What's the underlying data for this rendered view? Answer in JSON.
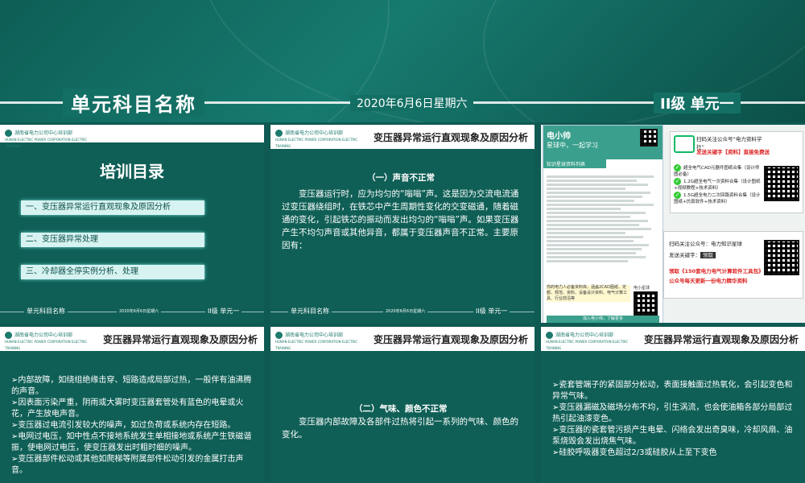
{
  "banner": {
    "title": "单元科目名称",
    "date": "2020年6月6日星期六",
    "level": "II级 单元一"
  },
  "org_name_cn": "湖南省电力公司中心培训部",
  "org_name_en": "HUNAN ELECTRIC POWER CORPORATION ELECTRIC TRAINING",
  "footer": {
    "unit": "单元科目名称",
    "date": "2020年6月6日星期六",
    "level": "II级 单元一"
  },
  "slide_title": "变压器异常运行直观现象及原因分析",
  "toc": {
    "title": "培训目录",
    "items": [
      "一、变压器异常运行直观现象及原因分析",
      "二、变压器异常处理",
      "三、冷却器全停实例分析、处理"
    ]
  },
  "slide2": {
    "heading": "（一）声音不正常",
    "para": "变压器运行时，应为均匀的“嗡嗡”声。这是因为交流电流通过变压器绕组时，在铁芯中产生周期性变化的交变磁通，随着磁通的变化，引起铁芯的振动而发出均匀的“嗡嗡”声。如果变压器产生不均匀声音或其他异音，都属于变压器声音不正常。主要原因有："
  },
  "slide4": {
    "items": [
      "➢内部故障，如绕组绝缘击穿、短路造成局部过热，一般伴有油沸腾的声音。",
      "➢因表面污染严重，阴雨或大雾时变压器套管处有蓝色的电晕或火花，产生放电声音。",
      "➢变压器过电流引发较大的噪声，如过负荷或系统内存在短路。",
      "➢电网过电压，如中性点不接地系统发生单相接地或系统产生铁磁谐振，使电网过电压，使变压器发出时粗时细的噪声。",
      "➢变压器部件松动或其他如爬梯等附属部件松动引发的金属打击声音。"
    ]
  },
  "slide5": {
    "heading": "（二）气味、颜色不正常",
    "para": "变压器内部故障及各部件过热将引起一系列的气味、颜色的变化。"
  },
  "slide6": {
    "items": [
      "➢瓷套管端子的紧固部分松动，表面接触面过热氧化，会引起变色和异常气味。",
      "➢变压器漏磁及磁场分布不均，引生涡流，也会使油箱各部分局部过热引起油漆变色。",
      "➢变压器的瓷套管污损产生电晕、闪络会发出奇臭味，冷却风扇、油泵烧毁会发出烧焦气味。",
      "➢硅胶呼吸器变色超过2/3或硅胶从上至下变色"
    ]
  },
  "ad": {
    "app_name": "电小帅",
    "app_sub": "星球中，一起学习",
    "tag": "知识星球资料列表",
    "promo": "你的电力人必备资料库，涵盖2CAD图纸、定额、规范、资料、设备设计资料、电气计算工具、行业前沿等",
    "scan_text": "加入电小帅，了解更多",
    "star_label": "电小星球",
    "wx1_title": "扫码关注公众号“电力资料学社”",
    "wx1_keyword": "发送关键字【资料】直接免费送",
    "offers": [
      "超全电气CAD元器件图纸合集（设计师图必备）",
      "1.2G超全电气一次资料合集（设计图纸+视频教程+技术资料）",
      "1.5G超全电力二次回路资料合集（设计图纸+仿真软件+技术资料）"
    ],
    "wx2_title": "扫码关注公众号：电力知识星球",
    "wx2_keyword": "发送关键字：",
    "wx2_key": "领取",
    "wx2_line1": "领取《150套电力电气计算软件工具包》",
    "wx2_line2": "公众号每天更新一份电力精华资料"
  }
}
